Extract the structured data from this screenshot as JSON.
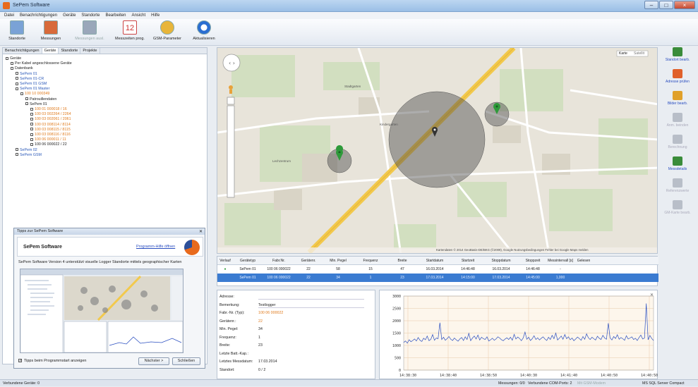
{
  "window": {
    "title": "SePem Software"
  },
  "menu": [
    "Datei",
    "Benachrichtigungen",
    "Geräte",
    "Standorte",
    "Bearbeiten",
    "Ansicht",
    "Hilfe"
  ],
  "toolbar": [
    {
      "label": "Standorte",
      "icon": "map-icon",
      "disabled": false
    },
    {
      "label": "Messungen",
      "icon": "measurement-icon",
      "disabled": false
    },
    {
      "label": "Messungen ausl.",
      "icon": "download-icon",
      "disabled": true
    },
    {
      "label": "Messzeiten prog.",
      "icon": "calendar-icon",
      "disabled": false
    },
    {
      "label": "GSM-Parameter",
      "icon": "gsm-icon",
      "disabled": false
    },
    {
      "label": "Aktualisieren",
      "icon": "refresh-icon",
      "disabled": false
    }
  ],
  "calendar_day": "12",
  "left_tabs": [
    "Benachrichtigungen",
    "Geräte",
    "Standorte",
    "Projekte"
  ],
  "tree": [
    {
      "label": "Geräte",
      "level": 0,
      "style": ""
    },
    {
      "label": "Per Kabel angeschlossene Geräte",
      "level": 1,
      "style": ""
    },
    {
      "label": "Datenbank",
      "level": 1,
      "style": ""
    },
    {
      "label": "SePem 01",
      "level": 2,
      "style": "b"
    },
    {
      "label": "SePem 01-CR",
      "level": 2,
      "style": "b"
    },
    {
      "label": "SePem 01 GSM",
      "level": 2,
      "style": "b"
    },
    {
      "label": "SePem 01 Master",
      "level": 2,
      "style": "b"
    },
    {
      "label": "100 10 000349",
      "level": 3,
      "style": "o"
    },
    {
      "label": "Patrouillendaten",
      "level": 4,
      "style": ""
    },
    {
      "label": "SePem 01",
      "level": 4,
      "style": ""
    },
    {
      "label": "100 01 000018 / 16",
      "level": 5,
      "style": "o"
    },
    {
      "label": "100 03 002264 / 2264",
      "level": 5,
      "style": "o"
    },
    {
      "label": "100 03 002061 / 2061",
      "level": 5,
      "style": "o"
    },
    {
      "label": "100 03 008114 / 8114",
      "level": 5,
      "style": "o"
    },
    {
      "label": "100 03 008115 / 8115",
      "level": 5,
      "style": "o"
    },
    {
      "label": "100 03 008116 / 8116",
      "level": 5,
      "style": "o"
    },
    {
      "label": "100 06 000011 / 11",
      "level": 5,
      "style": "o"
    },
    {
      "label": "100 06 000022 / 22",
      "level": 5,
      "style": ""
    },
    {
      "label": "SePem 02",
      "level": 2,
      "style": "b"
    },
    {
      "label": "SePem GSM",
      "level": 2,
      "style": "b"
    }
  ],
  "tips": {
    "title": "Tipps zur SePem Software",
    "heading": "SePem Software",
    "link": "Programm-Hilfe öffnen",
    "text": "SePem Software Version 4 unterstützt visuelle Logger Standorte mittels geographischer Karten",
    "checkbox": "Tipps beim Programmstart anzeigen",
    "next": "Nächster >",
    "close": "Schließen"
  },
  "map": {
    "type_buttons": [
      "Karte",
      "Satellit"
    ],
    "attribution": "Kartendaten © 2014 GeoBasis-DE/BKG (©2009), Google   Nutzungsbedingungen   Fehler bei Google Maps melden",
    "labels": [
      "Lechzentrum",
      "Stadtgarten",
      "Kindergarten"
    ]
  },
  "side_buttons": [
    {
      "label": "Standort bearb.",
      "icon": "location-edit-icon",
      "disabled": false,
      "color": "#3a8c3a"
    },
    {
      "label": "Adresse prüfen",
      "icon": "home-icon",
      "disabled": false,
      "color": "#e0602a"
    },
    {
      "label": "Bilder bearb.",
      "icon": "image-icon",
      "disabled": false,
      "color": "#e0a02a"
    },
    {
      "label": "Anm. beinden",
      "icon": "pin-icon",
      "disabled": true,
      "color": "#b8bec8"
    },
    {
      "label": "Berechnung",
      "icon": "calc-icon",
      "disabled": true,
      "color": "#b8bec8"
    },
    {
      "label": "Messdetails",
      "icon": "chart-icon",
      "disabled": false,
      "color": "#3a8c3a"
    },
    {
      "label": "Referenzwerte",
      "icon": "tool-icon",
      "disabled": true,
      "color": "#b8bec8"
    },
    {
      "label": "GM-Karte bearb.",
      "icon": "map-edit-icon",
      "disabled": true,
      "color": "#b8bec8"
    }
  ],
  "grid": {
    "columns": [
      "Verlauf",
      "Gerätetyp",
      "Fabr.Nr.",
      "Gerätenr.",
      "Min. Pegel",
      "Frequenz",
      "Breite",
      "Startdatum",
      "Startzeit",
      "Stoppdatum",
      "Stoppzeit",
      "Messintervall [s]",
      "Gelesen"
    ],
    "rows": [
      [
        "●",
        "SePem 01",
        "100 06 000022",
        "22",
        "58",
        "15",
        "47",
        "16.03.2014",
        "14:46:48",
        "16.03.2014",
        "14:46:48",
        "-",
        ""
      ],
      [
        "",
        "SePem 01",
        "100 06 000022",
        "22",
        "34",
        "1",
        "23",
        "17.03.2014",
        "14:15:00",
        "17.03.2014",
        "14:45:00",
        "1,000",
        ""
      ]
    ]
  },
  "details": [
    {
      "k": "Adresse:",
      "v": "",
      "o": false
    },
    {
      "k": "Bemerkung:",
      "v": "Testlogger",
      "o": false
    },
    {
      "k": "Fabr.-Nr. (Typ):",
      "v": "100 06 000022",
      "o": true
    },
    {
      "k": "Gerätenr.:",
      "v": "22",
      "o": true
    },
    {
      "k": "Min. Pegel:",
      "v": "34",
      "o": false
    },
    {
      "k": "Frequenz:",
      "v": "1",
      "o": false
    },
    {
      "k": "Breite:",
      "v": "23",
      "o": false
    },
    {
      "k": "Letzte Batt.-Kap.:",
      "v": "",
      "o": false
    },
    {
      "k": "Letztes Messdatum:",
      "v": "17.03.2014",
      "o": false
    },
    {
      "k": "Standort:",
      "v": "0 / 2",
      "o": false
    }
  ],
  "chart_data": {
    "type": "line",
    "ylim": [
      0,
      3000
    ],
    "yticks": [
      0,
      500,
      1000,
      1500,
      2000,
      2500,
      3000
    ],
    "xticks": [
      "14:38:30",
      "14:38:40",
      "14:38:50",
      "14:40:30",
      "14:41:40",
      "14:40:50",
      "14:40:50"
    ],
    "series": [
      {
        "color": "#2a4ec0",
        "values": [
          1120,
          1180,
          1090,
          1230,
          1150,
          1200,
          1260,
          1180,
          1320,
          1210,
          1160,
          1290,
          1230,
          1380,
          1190,
          1250,
          1440,
          1210,
          1300,
          1270,
          1920,
          1240,
          1330,
          1210,
          1280,
          1360,
          1250,
          1200,
          1300,
          1230,
          1170,
          1260,
          1320,
          1200,
          1350,
          1240,
          1490,
          1190,
          1300,
          1380,
          1260,
          1420,
          1220,
          1330,
          1270,
          1240,
          1350,
          1180,
          1230,
          1290,
          1210,
          1260,
          1350,
          1300,
          1230,
          1190,
          1260,
          1310,
          1240,
          1330,
          1210,
          1450,
          1260,
          1340,
          1280,
          1190,
          1300,
          1540,
          1250,
          1330,
          1200,
          1270,
          1390,
          1240,
          1310,
          1220,
          1290,
          1350,
          1260,
          1200,
          1330,
          1240,
          1410,
          1270,
          1500,
          1220,
          1290,
          1380,
          1250,
          1440,
          1270,
          1350,
          1230,
          1300,
          1190,
          1260,
          1340,
          1280,
          1210,
          1360,
          1250,
          1470,
          1310,
          1240,
          1330,
          1270,
          1220,
          1370,
          1290,
          1240,
          1410,
          1300,
          1250,
          1900,
          1310,
          1220,
          1360,
          1280,
          1430,
          1250,
          1320,
          1270,
          1210,
          1390,
          1260,
          1300,
          1350,
          1240,
          1290,
          1200,
          1320,
          1420,
          1260,
          1300,
          2700,
          1230,
          1400,
          1280,
          1200
        ]
      }
    ]
  },
  "status": {
    "left": "Verbundene Geräte: 0",
    "mid1": "Messungen: 0/0",
    "mid2": "Verbundene COM-Ports: 2",
    "mid3": "Mit GSM-Modem",
    "right": "MS SQL Server Compact"
  }
}
